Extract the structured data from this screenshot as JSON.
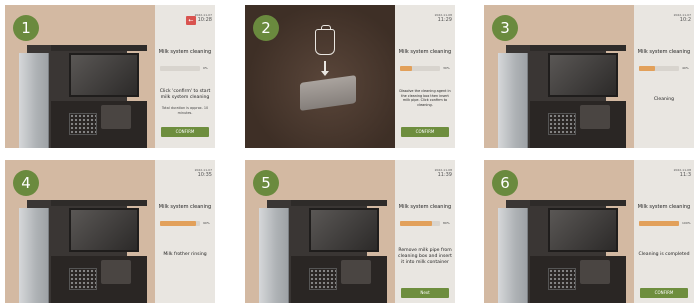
{
  "steps": [
    {
      "number": "1",
      "date": "2022-11-07",
      "time": "10:28",
      "title": "Milk system cleaning",
      "progress": 0.0,
      "percent": "0%",
      "message": "Click 'confirm' to start milk system cleaning",
      "note": "Total duration is approx. 10 minutes.",
      "button": "CONFIRM",
      "back_icon": "back-arrow-icon"
    },
    {
      "number": "2",
      "date": "2022-11-08",
      "time": "11:29",
      "title": "Milk system cleaning",
      "progress": 0.3,
      "percent": "30%",
      "message": "Dissolve the cleaning agent in the cleaning box then insert milk pipe. Click confirm to cleaning.",
      "button": "CONFIRM"
    },
    {
      "number": "3",
      "date": "2022-11-07",
      "time": "10:2",
      "title": "Milk system cleaning",
      "progress": 0.4,
      "percent": "40%",
      "message": "Cleaning"
    },
    {
      "number": "4",
      "date": "2022-11-07",
      "time": "10:35",
      "title": "Milk system cleaning",
      "progress": 0.9,
      "percent": "90%",
      "message": "Milk frother rinsing"
    },
    {
      "number": "5",
      "date": "2022-11-08",
      "time": "11:39",
      "title": "Milk system cleaning",
      "progress": 0.8,
      "percent": "80%",
      "message": "Remove milk pipe from cleaning box and insert it into milk container",
      "button": "Next"
    },
    {
      "number": "6",
      "date": "2022-11-08",
      "time": "11:3",
      "title": "Milk system cleaning",
      "progress": 1.0,
      "percent": "100%",
      "message": "Cleaning is completed",
      "button": "CONFIRM"
    }
  ],
  "colors": {
    "badge": "#6a8a3e",
    "button": "#6e8e3e",
    "progress_fill": "#e2a05a",
    "panel": "#e9e6e1",
    "back_button": "#d9534f"
  }
}
